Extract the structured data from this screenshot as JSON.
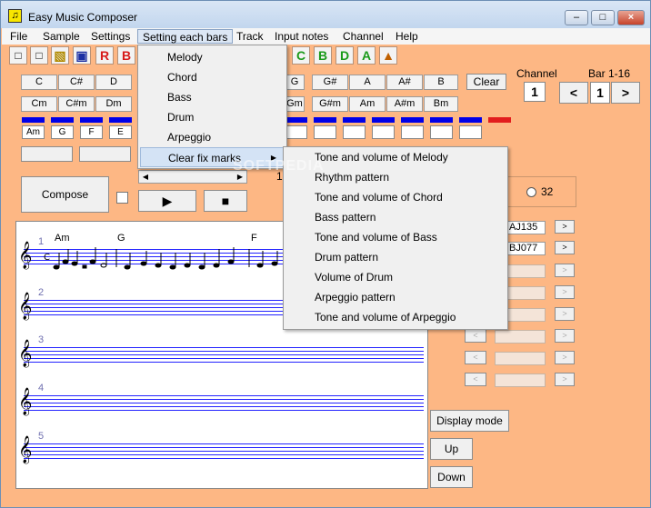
{
  "window": {
    "title": "Easy Music Composer",
    "app_icon": "♫"
  },
  "menubar": [
    "File",
    "Sample",
    "Settings",
    "Setting each bars",
    "Track",
    "Input notes",
    "Channel",
    "Help"
  ],
  "toolbar": {
    "letters": [
      "R",
      "B"
    ],
    "right_letters": [
      "C",
      "B",
      "D",
      "A"
    ]
  },
  "keys_row1_left": [
    "C",
    "C#",
    "D"
  ],
  "keys_row1_right": [
    "G",
    "G#",
    "A",
    "A#",
    "B"
  ],
  "keys_row2_left": [
    "Cm",
    "C#m",
    "Dm"
  ],
  "keys_row2_right": [
    "Gm",
    "G#m",
    "Am",
    "A#m",
    "Bm"
  ],
  "clear_label": "Clear",
  "channel": {
    "label": "Channel",
    "value": "1"
  },
  "bar": {
    "label": "Bar 1-16",
    "value": "1",
    "prev": "<",
    "next": ">"
  },
  "slot_values": [
    "Am",
    "G",
    "F",
    "E"
  ],
  "compose_label": "Compose",
  "play_label": "▶",
  "stop_label": "■",
  "radio_label": "32",
  "track_names": [
    "AJ135",
    "BJ077"
  ],
  "nav_buttons": {
    "left": "<",
    "right": ">"
  },
  "display_mode_label": "Display mode",
  "up_label": "Up",
  "down_label": "Down",
  "staff_numbers": [
    "1",
    "2",
    "3",
    "4",
    "5"
  ],
  "chord_labels": [
    "Am",
    "G",
    "F"
  ],
  "scroll_value": "1",
  "watermark": "SOFTPEDIA",
  "dropdown_bars": [
    "Melody",
    "Chord",
    "Bass",
    "Drum",
    "Arpeggio",
    "Clear fix marks"
  ],
  "dropdown_clear": [
    "Tone and volume of Melody",
    "Rhythm pattern",
    "Tone and volume of Chord",
    "Bass pattern",
    "Tone and volume of Bass",
    "Drum pattern",
    "Volume of Drum",
    "Arpeggio pattern",
    "Tone and volume of Arpeggio"
  ],
  "colors": {
    "background": "#fdb784",
    "staff_line": "#2323ff",
    "slot_bar": "#0000e8",
    "slot_bar_red": "#e21d1d",
    "menu_highlight": "#d4e3f5"
  }
}
